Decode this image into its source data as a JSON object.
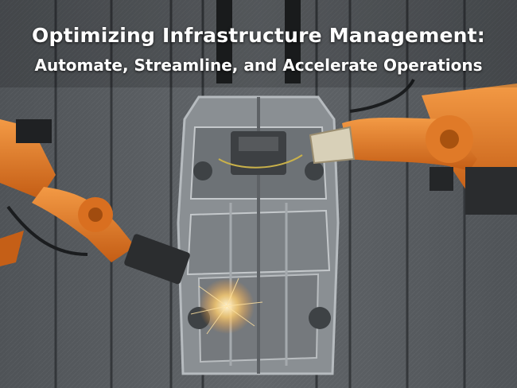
{
  "headline": {
    "line1": "Optimizing Infrastructure Management:",
    "line2": "Automate, Streamline, and Accelerate Operations"
  },
  "photo": {
    "subject": "robot-arm-car-assembly-line",
    "colors": {
      "robot": "#e27a2a",
      "floor": "#5b5f63",
      "frame": "#8d9296",
      "spark": "#ffd27a"
    }
  }
}
